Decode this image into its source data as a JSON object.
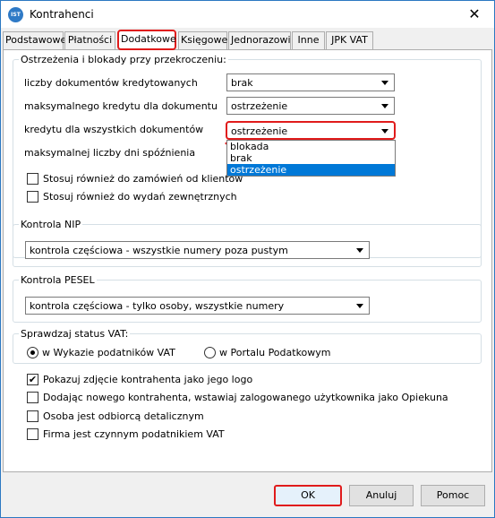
{
  "window": {
    "title": "Kontrahenci",
    "close_glyph": "✕",
    "icon_text": "IST"
  },
  "tabs": [
    {
      "label": "Podstawowe"
    },
    {
      "label": "Płatności"
    },
    {
      "label": "Dodatkowe",
      "active": true
    },
    {
      "label": "Księgowe"
    },
    {
      "label": "Jednorazowi"
    },
    {
      "label": "Inne"
    },
    {
      "label": "JPK VAT"
    }
  ],
  "warnings": {
    "legend": "Ostrzeżenia i blokady przy przekroczeniu:",
    "rows": [
      {
        "label": "liczby dokumentów kredytowanych",
        "value": "brak"
      },
      {
        "label": "maksymalnego kredytu dla  dokumentu",
        "value": "ostrzeżenie"
      },
      {
        "label": "kredytu dla wszystkich dokumentów",
        "value": "ostrzeżenie"
      },
      {
        "label": "maksymalnej liczby dni spóźnienia",
        "value": ""
      }
    ],
    "dropdown_options": [
      "blokada",
      "brak",
      "ostrzeżenie"
    ],
    "dropdown_selected": "ostrzeżenie",
    "check_orders": {
      "label": "Stosuj również do zamówień od klientów",
      "checked": false
    },
    "check_issues": {
      "label": "Stosuj również do wydań zewnętrznych",
      "checked": false
    }
  },
  "nip": {
    "legend": "Kontrola NIP",
    "value": "kontrola częściowa - wszystkie numery poza pustym"
  },
  "pesel": {
    "legend": "Kontrola PESEL",
    "value": "kontrola częściowa - tylko osoby, wszystkie numery"
  },
  "vat_status": {
    "legend": "Sprawdzaj status VAT:",
    "options": [
      {
        "label": "w Wykazie podatników VAT",
        "selected": true
      },
      {
        "label": "w Portalu Podatkowym",
        "selected": false
      }
    ]
  },
  "checkboxes": [
    {
      "label": "Pokazuj zdjęcie kontrahenta jako jego logo",
      "checked": true
    },
    {
      "label": "Dodając nowego kontrahenta, wstawiaj zalogowanego użytkownika jako Opiekuna",
      "checked": false
    },
    {
      "label": "Osoba jest odbiorcą detalicznym",
      "checked": false
    },
    {
      "label": "Firma jest czynnym podatnikiem VAT",
      "checked": false
    }
  ],
  "buttons": {
    "ok": "OK",
    "cancel": "Anuluj",
    "help": "Pomoc"
  },
  "check_glyph": "✔",
  "colors": {
    "highlight": "#e01b1b",
    "selection": "#0078d7",
    "window_border": "#2b78c2"
  }
}
